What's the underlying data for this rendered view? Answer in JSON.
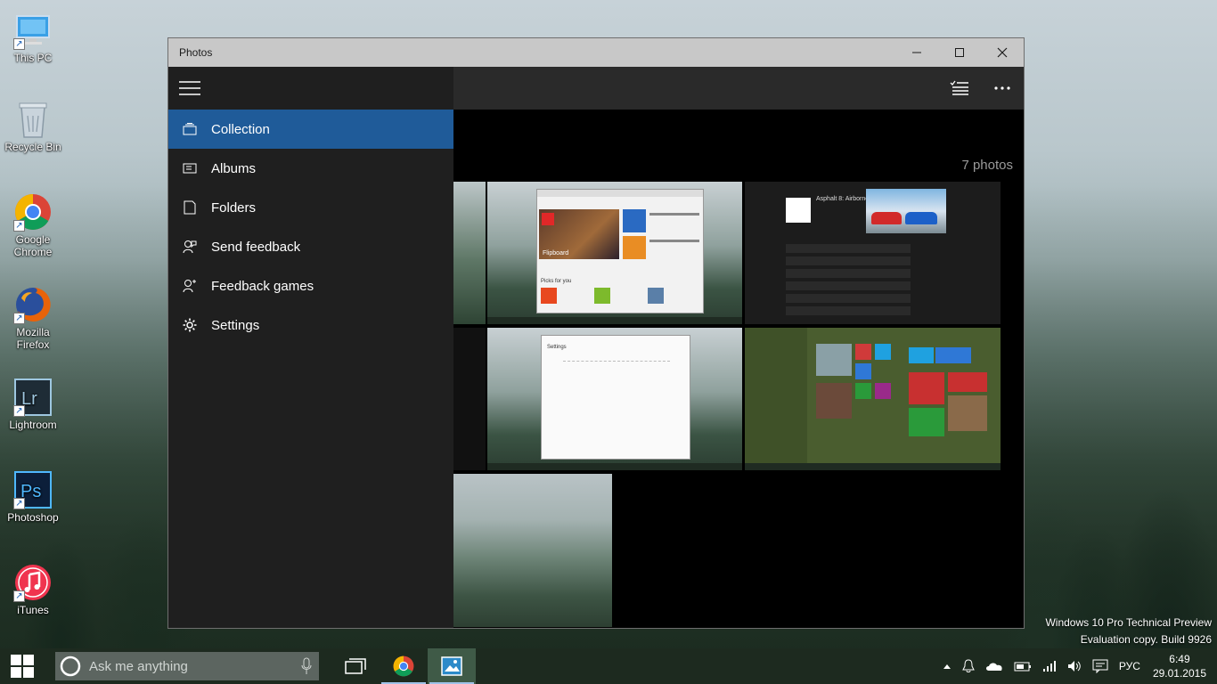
{
  "desktop": {
    "icons": [
      {
        "label": "This PC"
      },
      {
        "label": "Recycle Bin"
      },
      {
        "label": "Google Chrome"
      },
      {
        "label": "Mozilla Firefox"
      },
      {
        "label": "Lightroom"
      },
      {
        "label": "Photoshop"
      },
      {
        "label": "iTunes"
      }
    ],
    "watermark": {
      "line1": "Windows 10 Pro Technical Preview",
      "line2": "Evaluation copy. Build 9926"
    }
  },
  "window": {
    "title": "Photos",
    "nav": [
      {
        "label": "Collection",
        "icon": "collection-icon",
        "selected": true
      },
      {
        "label": "Albums",
        "icon": "albums-icon"
      },
      {
        "label": "Folders",
        "icon": "folder-icon"
      },
      {
        "label": "Send feedback",
        "icon": "feedback-icon"
      },
      {
        "label": "Feedback games",
        "icon": "feedback-games-icon"
      },
      {
        "label": "Settings",
        "icon": "gear-icon"
      }
    ],
    "photo_count": "7 photos",
    "thumbnails": {
      "store_title": "Flipboard",
      "game_title": "Asphalt 8: Airborne",
      "settings_title": "Settings",
      "picks_title": "Picks for you"
    }
  },
  "taskbar": {
    "search_placeholder": "Ask me anything",
    "language": "РУС",
    "time": "6:49",
    "date": "29.01.2015"
  },
  "colors": {
    "accent": "#1f5b99",
    "sidebar": "#1f1f1f",
    "titlebar": "#c8c8c8",
    "taskbar": "#1d2a1f"
  }
}
